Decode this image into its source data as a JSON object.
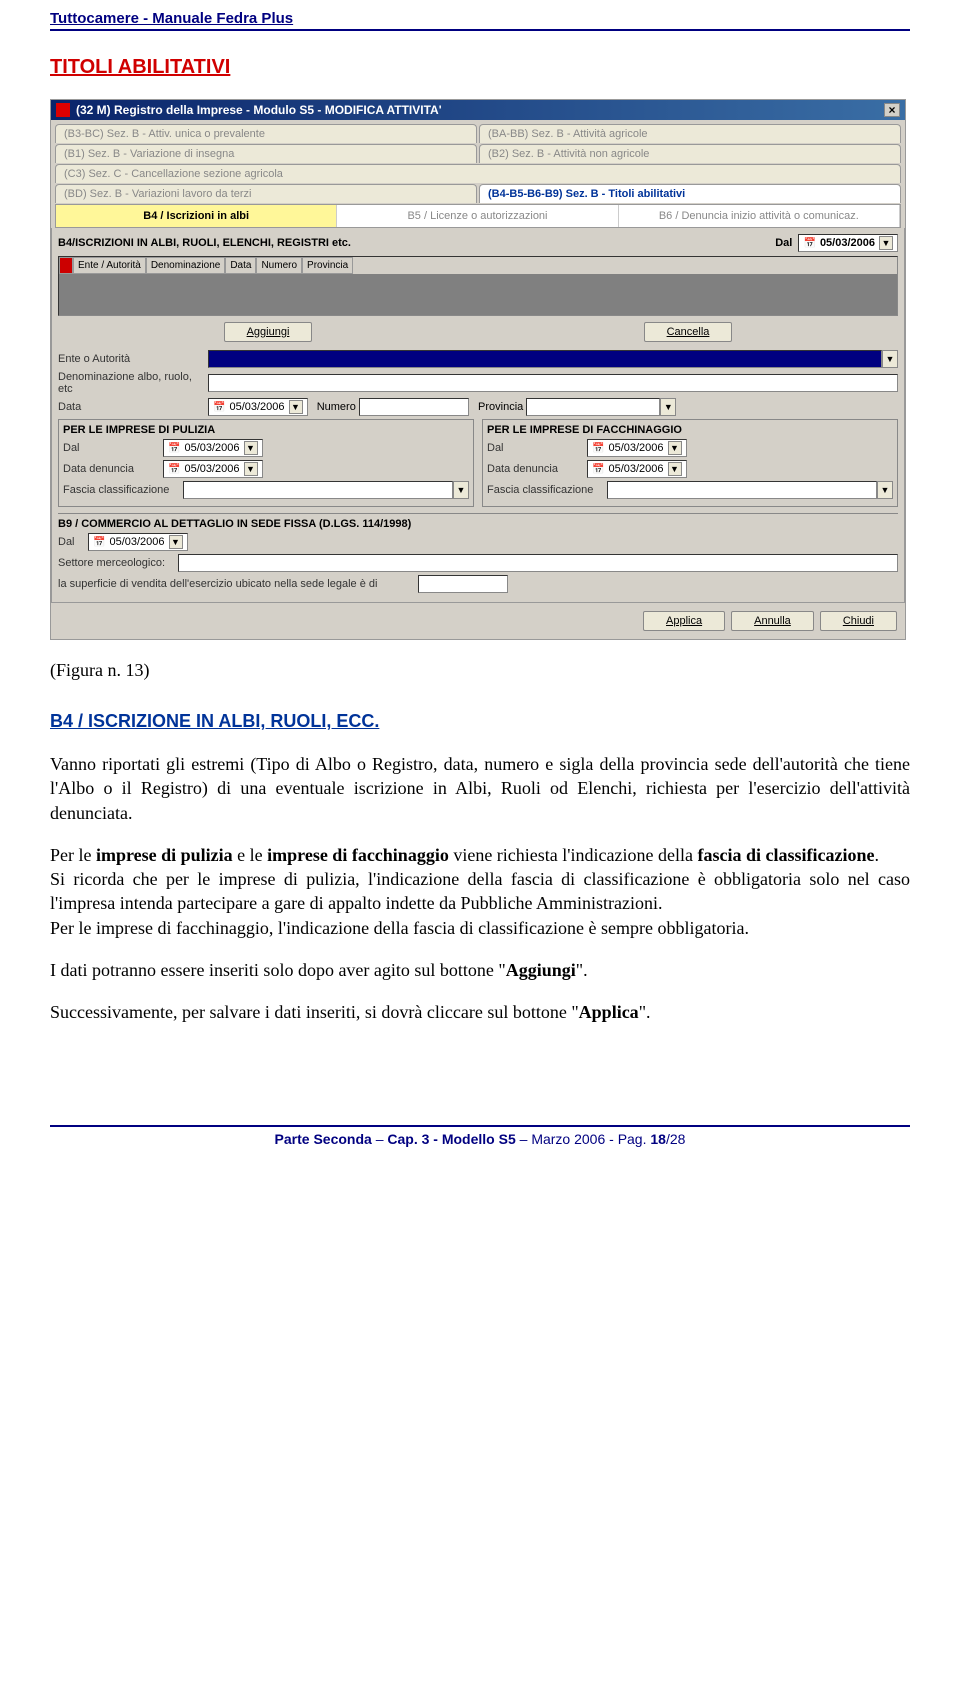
{
  "headerLine": "Tuttocamere - Manuale Fedra Plus",
  "headingRed": "TITOLI ABILITATIVI",
  "window": {
    "title": "(32 M) Registro della Imprese - Modulo S5 - MODIFICA ATTIVITA'",
    "tabs": {
      "r1a": "(B3-BC) Sez. B - Attiv. unica o prevalente",
      "r1b": "(BA-BB) Sez. B - Attività agricole",
      "r2a": "(B1) Sez. B - Variazione di insegna",
      "r2b": "(B2) Sez. B - Attività non agricole",
      "r3a": "(C3) Sez. C - Cancellazione sezione agricola",
      "r4a": "(BD) Sez. B - Variazioni lavoro da terzi",
      "r4b": "(B4-B5-B6-B9) Sez. B - Titoli abilitativi"
    },
    "subtabs": {
      "a": "B4 / Iscrizioni in albi",
      "b": "B5 / Licenze o autorizzazioni",
      "c": "B6 / Denuncia inizio attività o comunicaz."
    },
    "b4title": "B4/ISCRIZIONI IN ALBI, RUOLI, ELENCHI, REGISTRI etc.",
    "dalLabel": "Dal",
    "date": "05/03/2006",
    "gridCols": [
      "Ente / Autorità",
      "Denominazione",
      "Data",
      "Numero",
      "Provincia"
    ],
    "btnAggiungi": "Aggiungi",
    "btnCancella": "Cancella",
    "fields": {
      "ente": "Ente o Autorità",
      "denom": "Denominazione albo, ruolo, etc",
      "data": "Data",
      "numero": "Numero",
      "provincia": "Provincia"
    },
    "pulizia": {
      "title": "PER LE IMPRESE DI PULIZIA",
      "dal": "Dal",
      "denuncia": "Data denuncia",
      "fascia": "Fascia classificazione"
    },
    "facchinaggio": {
      "title": "PER LE IMPRESE DI FACCHINAGGIO",
      "dal": "Dal",
      "denuncia": "Data denuncia",
      "fascia": "Fascia classificazione"
    },
    "b9": {
      "title": "B9 / COMMERCIO AL DETTAGLIO IN SEDE FISSA (D.LGS. 114/1998)",
      "dal": "Dal",
      "settore": "Settore merceologico:",
      "superficie": "la superficie di vendita dell'esercizio ubicato nella sede legale è di"
    },
    "btnApplica": "Applica",
    "btnAnnulla": "Annulla",
    "btnChiudi": "Chiudi"
  },
  "figureCaption": "(Figura n. 13)",
  "secHeading": "B4 / ISCRIZIONE IN ALBI, RUOLI, ECC.",
  "para1": "Vanno riportati gli estremi (Tipo di Albo o Registro, data, numero e sigla della provincia sede dell'autorità che tiene l'Albo o il Registro) di una eventuale iscrizione in Albi, Ruoli od Elenchi, richiesta per l'esercizio dell'attività denunciata.",
  "para2_a": "Per le ",
  "para2_b": "imprese di pulizia",
  "para2_c": " e le ",
  "para2_d": "imprese di facchinaggio",
  "para2_e": " viene richiesta l'indicazione della ",
  "para2_f": "fascia di classificazione",
  "para2_g": ".",
  "para3": "Si ricorda che per le imprese di pulizia, l'indicazione della fascia di classificazione è obbligatoria solo nel caso l'impresa intenda partecipare a gare di appalto indette da Pubbliche Amministrazioni.",
  "para4": "Per le imprese di facchinaggio, l'indicazione della fascia di classificazione è sempre obbligatoria.",
  "para5_a": "I dati potranno essere inseriti solo dopo aver agito sul bottone \"",
  "para5_b": "Aggiungi",
  "para5_c": "\".",
  "para6_a": "Successivamente, per salvare i dati inseriti, si dovrà cliccare sul bottone \"",
  "para6_b": "Applica",
  "para6_c": "\".",
  "footer_a": "Parte Seconda",
  "footer_b": " – ",
  "footer_c": "Cap. 3 - Modello S5",
  "footer_d": " – Marzo 2006 - Pag. ",
  "footer_e": "18",
  "footer_f": "/28"
}
